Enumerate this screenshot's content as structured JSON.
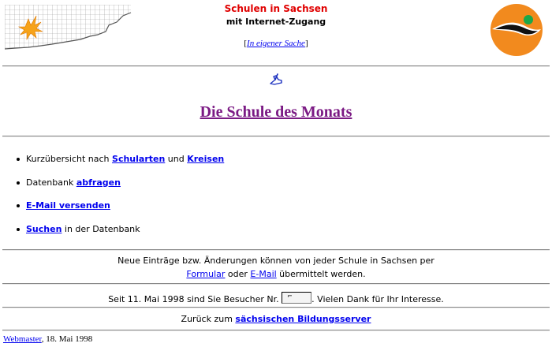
{
  "header": {
    "site_title": "Schulen in Sachsen",
    "site_subtitle": "mit Internet-Zugang",
    "own_affairs_open": "[",
    "own_affairs_link": "In eigener Sache",
    "own_affairs_close": "]"
  },
  "page_title": "Die Schule des Monats",
  "menu": {
    "item1": {
      "text_before": "Kurzübersicht nach ",
      "link1": "Schularten",
      "text_mid": " und ",
      "link2": "Kreisen"
    },
    "item2": {
      "text_before": "Datenbank ",
      "link": "abfragen"
    },
    "item3": {
      "link": "E-Mail versenden"
    },
    "item4": {
      "link": "Suchen",
      "text_after": " in der Datenbank"
    }
  },
  "notice": {
    "line1": "Neue Einträge bzw. Änderungen können von jeder Schule in Sachsen per",
    "link_form": "Formular",
    "text_or": " oder ",
    "link_email": "E-Mail",
    "text_after": " übermittelt werden."
  },
  "visitors": {
    "text_before": "Seit 11. Mai 1998 sind Sie Besucher Nr. ",
    "counter": "⌐",
    "text_after": ". Vielen Dank für Ihr Interesse."
  },
  "back": {
    "text_before": "Zurück zum ",
    "link": "sächsischen Bildungsserver"
  },
  "footer": {
    "link": "Webmaster",
    "date": ", 18. Mai 1998"
  },
  "colors": {
    "title_red": "#e00000",
    "heading_purple": "#7b1a84",
    "link_blue": "#0000ee",
    "logo_orange": "#f28a1e"
  },
  "icons": [
    "saxony-map-icon",
    "logo-icon",
    "pointing-hand-icon"
  ]
}
